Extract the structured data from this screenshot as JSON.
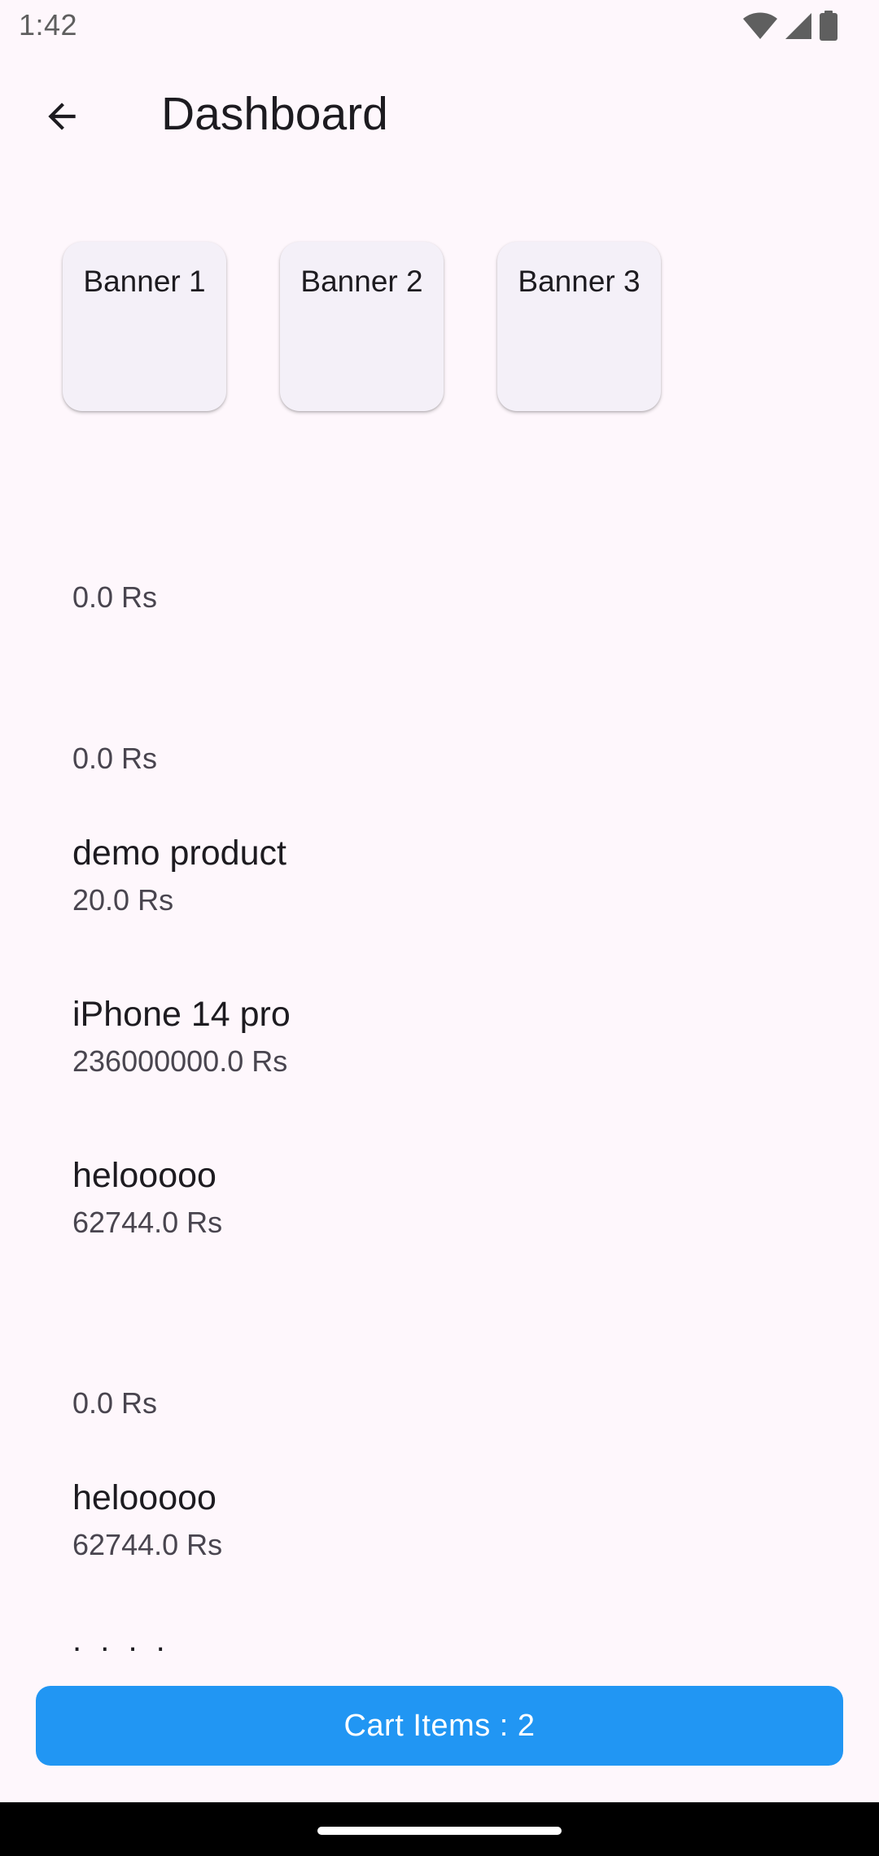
{
  "status_bar": {
    "time": "1:42",
    "icons": [
      "wifi-icon",
      "cellular-signal-icon",
      "battery-icon"
    ]
  },
  "app_bar": {
    "back_icon": "arrow-left-icon",
    "title": "Dashboard"
  },
  "banners": [
    {
      "label": "Banner 1"
    },
    {
      "label": "Banner 2"
    },
    {
      "label": "Banner 3"
    }
  ],
  "products": [
    {
      "name": "",
      "price": "0.0 Rs"
    },
    {
      "name": "",
      "price": "0.0 Rs"
    },
    {
      "name": "demo product",
      "price": "20.0 Rs"
    },
    {
      "name": "iPhone 14 pro",
      "price": "236000000.0 Rs"
    },
    {
      "name": "helooooo",
      "price": "62744.0 Rs"
    },
    {
      "name": "",
      "price": "0.0 Rs"
    },
    {
      "name": "helooooo",
      "price": "62744.0 Rs"
    }
  ],
  "more_indicator": ". . . .",
  "cart": {
    "label": "Cart Items : 2"
  },
  "colors": {
    "background": "#fef7fc",
    "banner_card": "#f4f0f8",
    "primary_button": "#2196f3",
    "text_primary": "#1d1b20",
    "text_secondary": "#49454f"
  }
}
